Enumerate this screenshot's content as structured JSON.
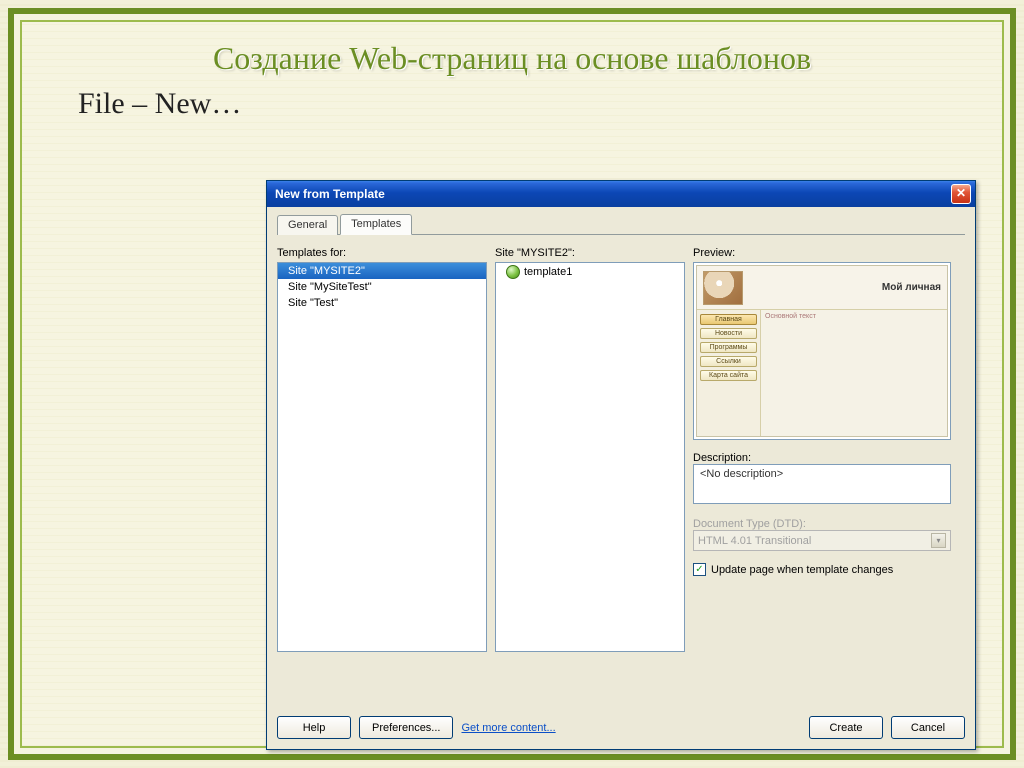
{
  "slide": {
    "title": "Создание Web-страниц на основе шаблонов",
    "subtitle": "File – New…"
  },
  "dialog": {
    "title": "New from Template",
    "tabs": {
      "general": "General",
      "templates": "Templates"
    },
    "labels": {
      "templates_for": "Templates for:",
      "site_list_header": "Site \"MYSITE2\":",
      "preview": "Preview:",
      "description": "Description:",
      "dtd": "Document Type (DTD):",
      "update_chk": "Update page when template changes"
    },
    "sites": [
      {
        "label": "Site \"MYSITE2\"",
        "selected": true
      },
      {
        "label": "Site \"MySiteTest\"",
        "selected": false
      },
      {
        "label": "Site \"Test\"",
        "selected": false
      }
    ],
    "templates": [
      {
        "label": "template1"
      }
    ],
    "preview": {
      "header_title": "Мой личная",
      "main_text": "Основной текст",
      "nav": [
        "Главная",
        "Новости",
        "Программы",
        "Ссылки",
        "Карта сайта"
      ]
    },
    "description_value": "<No description>",
    "dtd_value": "HTML 4.01 Transitional",
    "buttons": {
      "help": "Help",
      "prefs": "Preferences...",
      "more": "Get more content...",
      "create": "Create",
      "cancel": "Cancel"
    }
  }
}
